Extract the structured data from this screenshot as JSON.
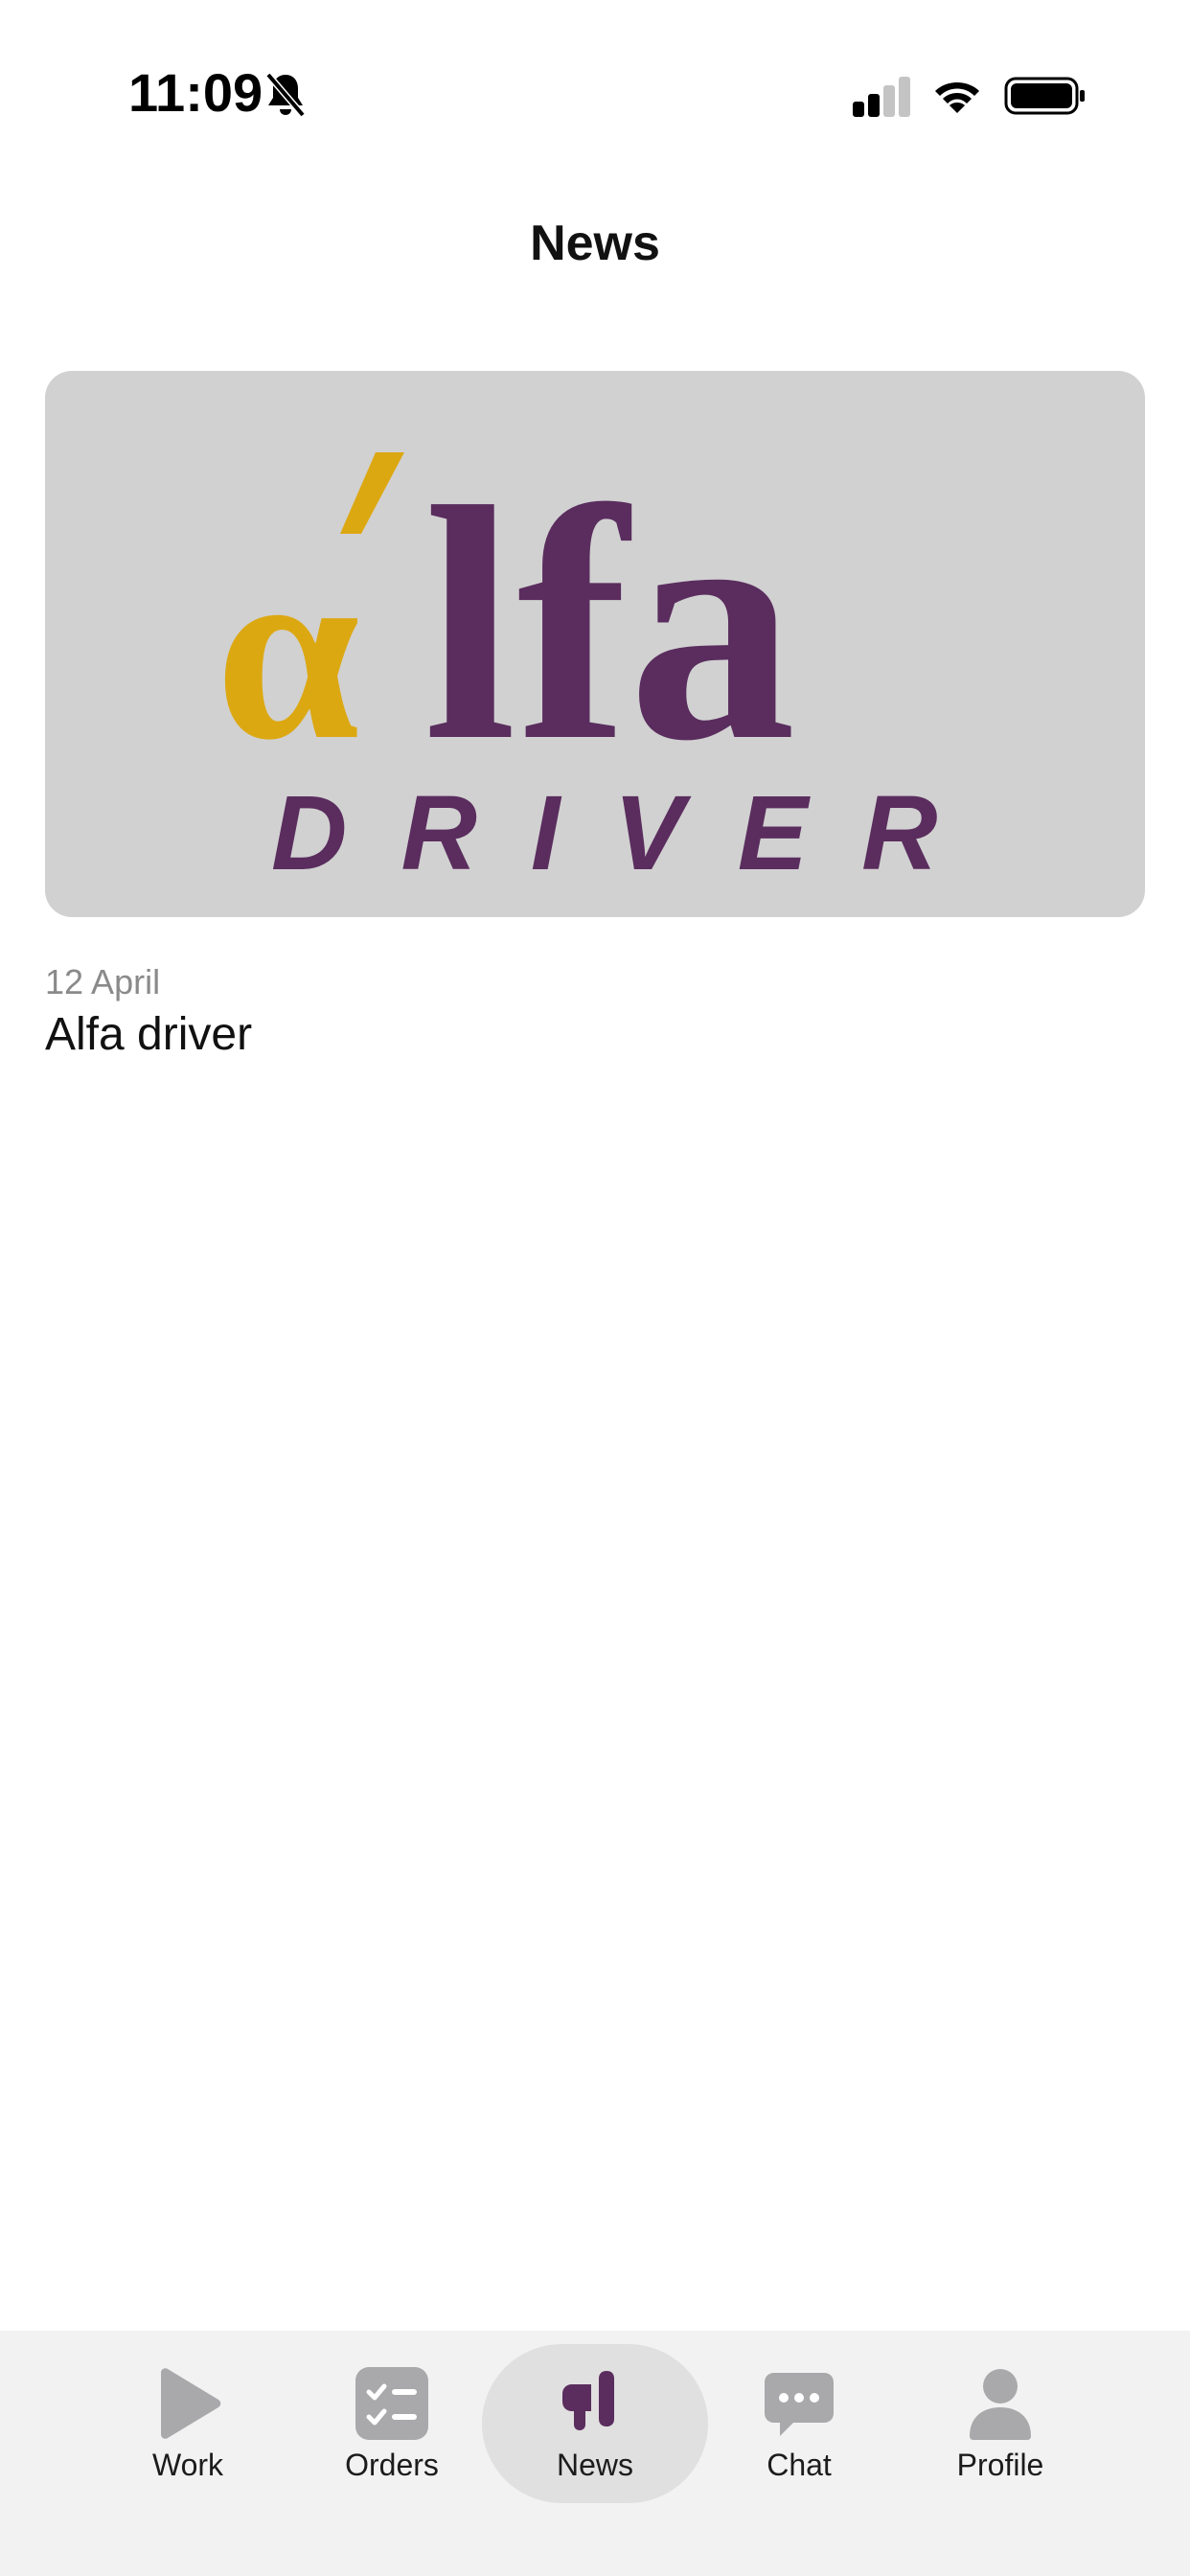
{
  "status_bar": {
    "time": "11:09",
    "icons": [
      "bell-slash-icon",
      "signal-icon",
      "wifi-icon",
      "battery-icon"
    ]
  },
  "header": {
    "title": "News"
  },
  "news": {
    "items": [
      {
        "image": "alfa-driver-logo",
        "logo_text_main": "άlfa",
        "logo_text_sub": "DRIVER",
        "date": "12 April",
        "title": "Alfa driver"
      }
    ]
  },
  "tab_bar": {
    "tabs": [
      {
        "label": "Work",
        "icon": "play-icon",
        "active": false
      },
      {
        "label": "Orders",
        "icon": "checklist-icon",
        "active": false
      },
      {
        "label": "News",
        "icon": "megaphone-icon",
        "active": true
      },
      {
        "label": "Chat",
        "icon": "chat-bubble-icon",
        "active": false
      },
      {
        "label": "Profile",
        "icon": "person-icon",
        "active": false
      }
    ]
  },
  "colors": {
    "accent": "#5a2d5e",
    "logo_yellow": "#dca812",
    "logo_purple": "#5a2d5e",
    "inactive_icon": "#a9a9ab",
    "card_bg": "#d1d1d1",
    "tab_bar_bg": "#f2f2f2"
  }
}
